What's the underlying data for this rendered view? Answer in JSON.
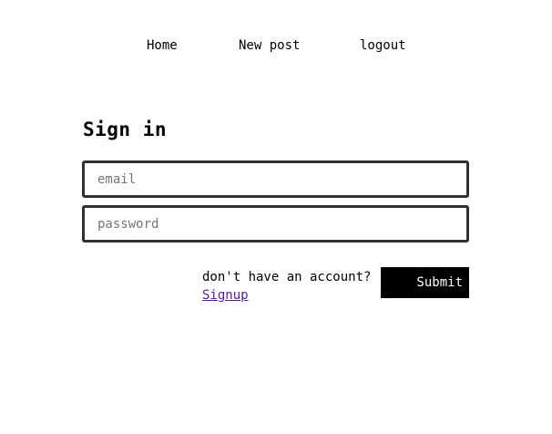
{
  "nav": {
    "home": "Home",
    "new_post": "New post",
    "logout": "logout"
  },
  "form": {
    "title": "Sign in",
    "email": {
      "placeholder": "email",
      "value": ""
    },
    "password": {
      "placeholder": "password",
      "value": ""
    },
    "account_prompt": "don't have an account?",
    "signup_link": "Signup",
    "submit_label": "Submit"
  },
  "colors": {
    "accent": "#000000",
    "link": "#5a1d96",
    "border": "#303030",
    "placeholder": "#6f7682"
  }
}
